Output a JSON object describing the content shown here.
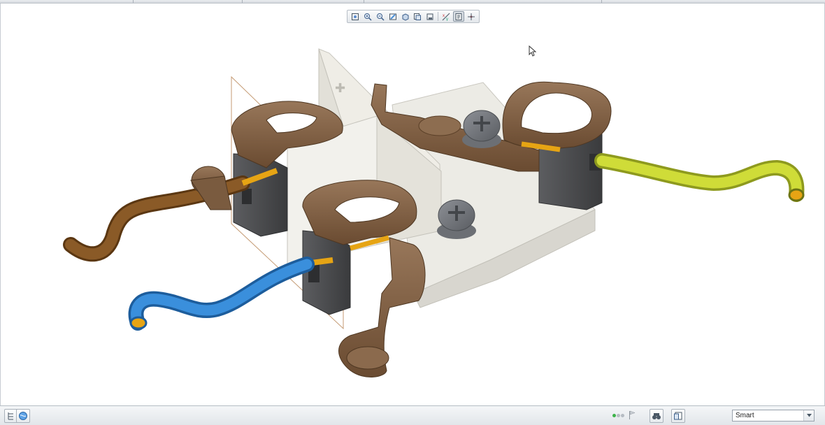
{
  "window": {
    "title": ""
  },
  "view_toolbar": {
    "buttons": [
      {
        "icon": "refit-icon"
      },
      {
        "icon": "zoom-in-icon"
      },
      {
        "icon": "zoom-out-icon"
      },
      {
        "icon": "repaint-icon"
      },
      {
        "icon": "display-style-icon"
      },
      {
        "icon": "saved-views-icon"
      },
      {
        "icon": "view-manager-icon"
      },
      {
        "icon": "datum-display-icon"
      },
      {
        "icon": "annotation-display-icon",
        "active": true
      },
      {
        "icon": "spin-center-icon"
      }
    ]
  },
  "statusbar": {
    "left_buttons": [
      {
        "icon": "navigator-toggle-icon"
      },
      {
        "icon": "browser-toggle-icon"
      }
    ],
    "regen_status": "regenerated",
    "regen_color": "#3db34a",
    "right_buttons": [
      {
        "icon": "find-icon"
      },
      {
        "icon": "selection-filter-icon"
      }
    ],
    "filter": {
      "selected": "Smart"
    }
  },
  "colors": {
    "terminal_brown": "#7a5b3f",
    "housing_white": "#ece9e0",
    "insulator_dark": "#4a4b4d",
    "wire_brown": "#7a4b1e",
    "wire_blue": "#2f7fcf",
    "wire_green_yellow": "#c8d631",
    "conductor": "#e6a414",
    "accent": "#3db34a"
  }
}
